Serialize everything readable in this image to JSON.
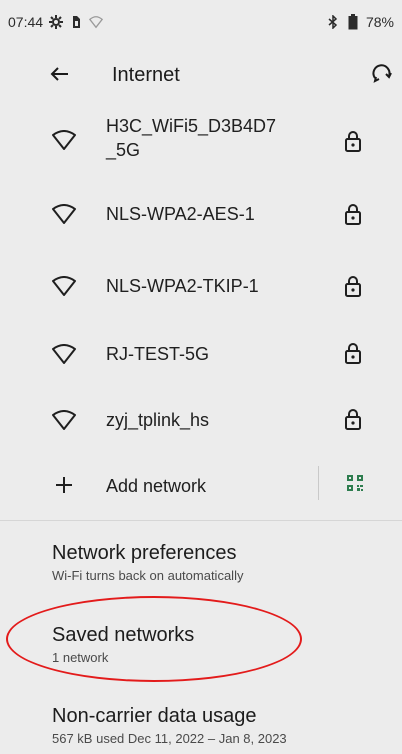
{
  "status_bar": {
    "time": "07:44",
    "battery": "78%",
    "icons": [
      "gear-icon",
      "sim-icon",
      "wifi-icon",
      "bluetooth-icon",
      "battery-icon"
    ]
  },
  "app_bar": {
    "title": "Internet",
    "back_icon": "arrow-back-icon",
    "help_icon": "help-icon"
  },
  "networks": [
    {
      "name": "H3C_WiFi5_D3B4D7_5G",
      "display_line1": "H3C_WiFi5_D3B4D7",
      "display_line2": "_5G",
      "secured": true
    },
    {
      "name": "NLS-WPA2-AES-1",
      "secured": true
    },
    {
      "name": "NLS-WPA2-TKIP-1",
      "secured": true
    },
    {
      "name": "RJ-TEST-5G",
      "secured": true
    },
    {
      "name": "zyj_tplink_hs",
      "secured": true
    }
  ],
  "add_network": {
    "label": "Add network",
    "qr_icon": "qr-scan-icon"
  },
  "preferences": [
    {
      "title": "Network preferences",
      "subtitle": "Wi-Fi turns back on automatically"
    },
    {
      "title": "Saved networks",
      "subtitle": "1 network"
    },
    {
      "title": "Non-carrier data usage",
      "subtitle": "567 kB used Dec 11, 2022 – Jan 8, 2023"
    }
  ],
  "colors": {
    "background": "#ececec",
    "annotation": "#e31b1b"
  }
}
